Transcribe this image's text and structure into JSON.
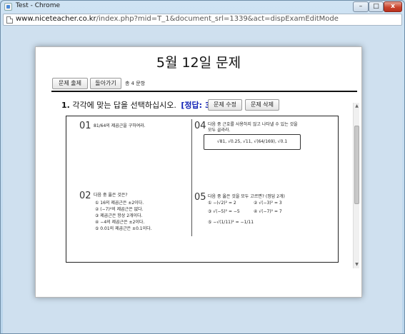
{
  "window": {
    "title": "Test - Chrome",
    "controls": {
      "minimize": "–",
      "maximize": "□",
      "close": "x"
    }
  },
  "address": {
    "host": "www.niceteacher.co.kr",
    "path": "/index.php?mid=T_1&document_srl=1339&act=dispExamEditMode"
  },
  "popup": {
    "title": "5월 12일 문제",
    "buttons": {
      "solve": "문제 출제",
      "back": "돌아가기"
    },
    "count": "총 4 문항"
  },
  "question": {
    "number": "1.",
    "text": "각각에 맞는 답을 선택하십시오.",
    "answer": "[정답: 3]",
    "edit_label": "문제 수정",
    "delete_label": "문제 삭제"
  },
  "sheet": {
    "p01": {
      "num": "01",
      "text": "81/64의 제곱근을 구하여라."
    },
    "p02": {
      "num": "02",
      "text": "다음 중 옳은 것은?",
      "options": [
        "① 16의 제곱근은 ±2이다.",
        "② (−7)²의 제곱근은 없다.",
        "③ 제곱근은 항상 2개이다.",
        "④ −4의 제곱근은 ±2이다.",
        "⑤ 0.01의 제곱근은 ±0.1이다."
      ]
    },
    "p04": {
      "num": "04",
      "text1": "다음 중 근호를 사용하지 않고 나타낼 수 있는 것을",
      "text2": "모두 골라라.",
      "box": "√81,  √0.25,  √11,  √(64/169),  √0.1"
    },
    "p05": {
      "num": "05",
      "text": "다음 중 옳은 것을 모두 고르면? (정답 2개)",
      "options": [
        "① −(√2)² = 2",
        "② √(−3)² = 3",
        "③ √(−5)² = −5",
        "④ √(−7)² = 7",
        "⑤ −√(1/11)² = −1/11"
      ]
    }
  }
}
